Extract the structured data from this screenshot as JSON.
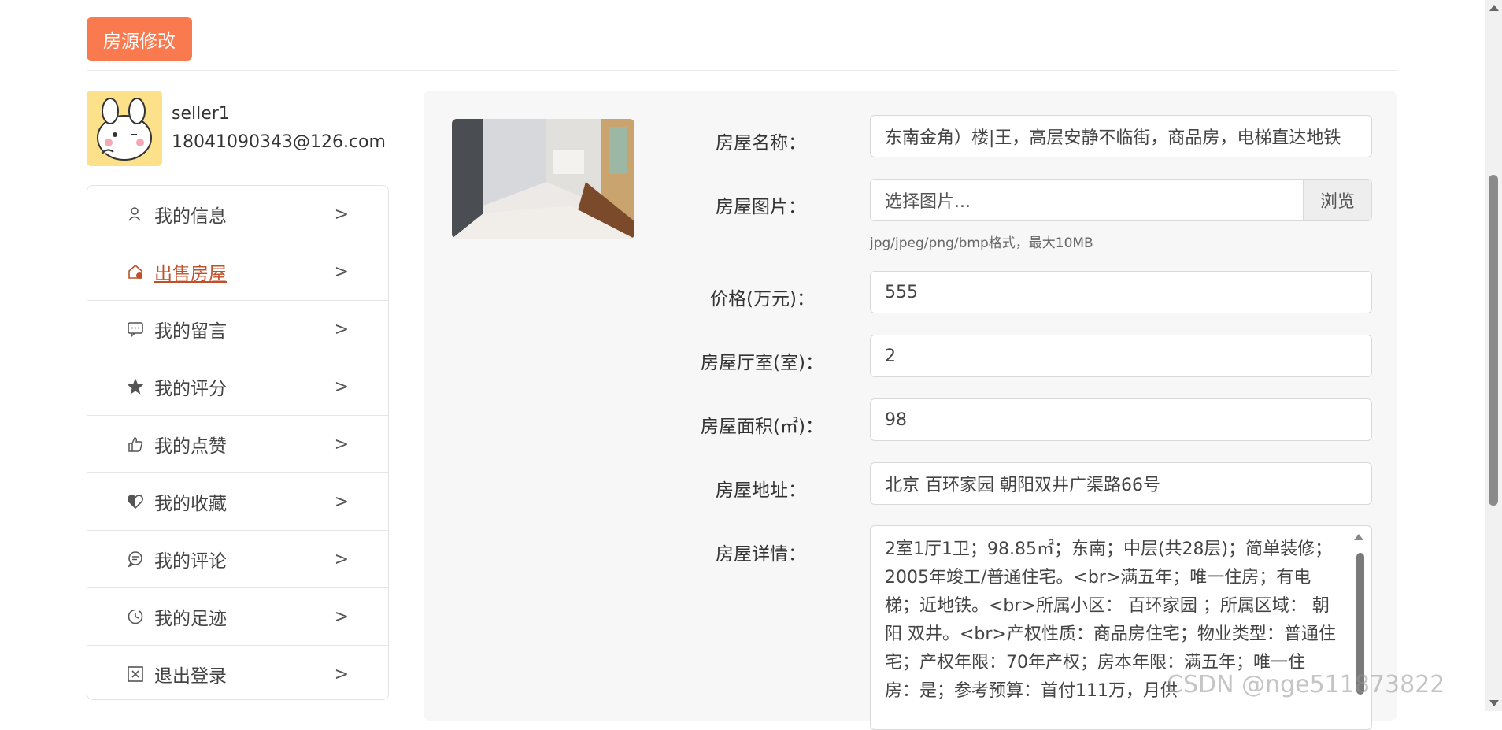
{
  "header": {
    "title_button": "房源修改"
  },
  "profile": {
    "username": "seller1",
    "email": "18041090343@126.com"
  },
  "menu": {
    "items": [
      {
        "label": "我的信息",
        "icon": "user-icon"
      },
      {
        "label": "出售房屋",
        "icon": "house-icon",
        "active": true
      },
      {
        "label": "我的留言",
        "icon": "message-icon"
      },
      {
        "label": "我的评分",
        "icon": "star-icon"
      },
      {
        "label": "我的点赞",
        "icon": "thumbs-up-icon"
      },
      {
        "label": "我的收藏",
        "icon": "heart-icon"
      },
      {
        "label": "我的评论",
        "icon": "comment-icon"
      },
      {
        "label": "我的足迹",
        "icon": "clock-icon"
      },
      {
        "label": "退出登录",
        "icon": "close-box-icon"
      }
    ],
    "chevron": ">"
  },
  "form": {
    "name": {
      "label": "房屋名称：",
      "value": "东南金角）楼|王，高层安静不临街，商品房，电梯直达地铁"
    },
    "image": {
      "label": "房屋图片：",
      "placeholder": "选择图片...",
      "browse_label": "浏览",
      "hint": "jpg/jpeg/png/bmp格式，最大10MB"
    },
    "price": {
      "label": "价格(万元)：",
      "value": "555"
    },
    "rooms": {
      "label": "房屋厅室(室)：",
      "value": "2"
    },
    "area": {
      "label": "房屋面积(㎡)：",
      "value": "98"
    },
    "address": {
      "label": "房屋地址：",
      "value": "北京 百环家园 朝阳双井广渠路66号"
    },
    "details": {
      "label": "房屋详情：",
      "value": "2室1厅1卫；98.85㎡；东南；中层(共28层)；简单装修；2005年竣工/普通住宅。<br>满五年；唯一住房；有电梯；近地铁。<br>所属小区： 百环家园 ；所属区域： 朝阳 双井。<br>产权性质：商品房住宅；物业类型：普通住宅；产权年限：70年产权；房本年限：满五年；唯一住房：是；参考预算：首付111万，月供"
    }
  },
  "watermark": "CSDN @nge511873822",
  "colors": {
    "accent": "#fa7a50",
    "active_text": "#c0502b"
  }
}
